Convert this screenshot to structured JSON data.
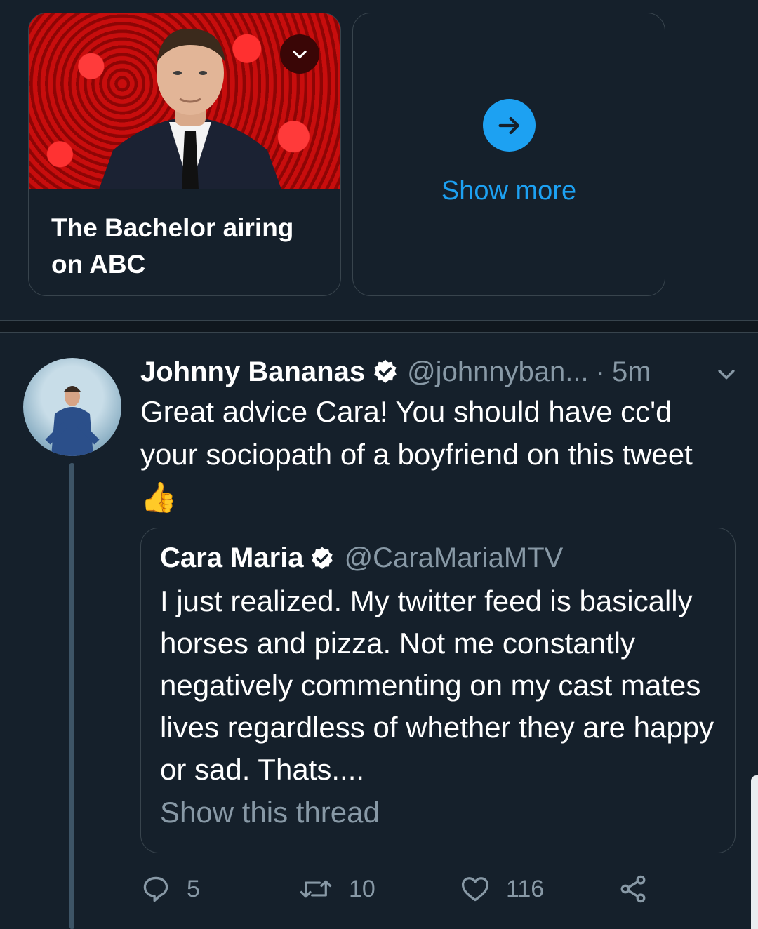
{
  "cards": {
    "bachelor": {
      "title": "The Bachelor airing on ABC"
    },
    "more": {
      "label": "Show more"
    }
  },
  "tweet": {
    "author": "Johnny Bananas",
    "handle": "@johnnyban...",
    "separator": "·",
    "time": "5m",
    "text": "Great advice Cara! You should have cc'd your sociopath of a boyfriend on this tweet",
    "emoji": "👍",
    "quote": {
      "author": "Cara Maria",
      "handle": "@CaraMariaMTV",
      "text": "I just realized. My twitter feed is basically horses and pizza. Not me constantly negatively commenting on my cast mates lives regardless of whether they are happy or sad. Thats....",
      "thread_link": "Show this thread"
    },
    "actions": {
      "replies": "5",
      "retweets": "10",
      "likes": "116"
    }
  },
  "colors": {
    "background": "#15202b",
    "accent": "#1da1f2",
    "muted": "#8899a6",
    "border": "#38444d"
  },
  "icons": [
    "chevron-down-icon",
    "arrow-right-icon",
    "verified-badge-icon",
    "reply-icon",
    "retweet-icon",
    "like-icon",
    "share-icon"
  ]
}
